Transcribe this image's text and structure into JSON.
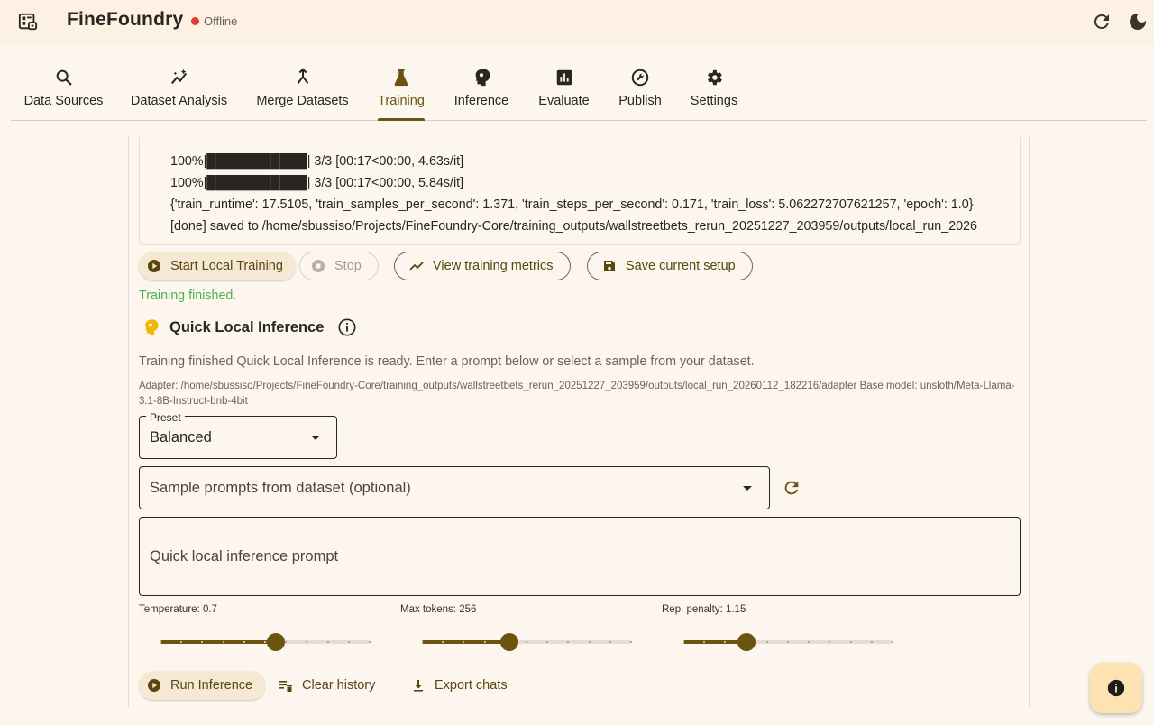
{
  "app": {
    "title": "FineFoundry",
    "status": "Offline",
    "status_color": "#e53935",
    "accent_color": "#6b5410",
    "icons": [
      "app-logo-icon",
      "refresh-icon",
      "dark-mode-icon"
    ]
  },
  "tabs": [
    {
      "label": "Data Sources",
      "icon": "search-icon"
    },
    {
      "label": "Dataset Analysis",
      "icon": "analytics-icon"
    },
    {
      "label": "Merge Datasets",
      "icon": "merge-icon"
    },
    {
      "label": "Training",
      "icon": "flask-icon",
      "active": true
    },
    {
      "label": "Inference",
      "icon": "psychology-icon"
    },
    {
      "label": "Evaluate",
      "icon": "bar-chart-icon"
    },
    {
      "label": "Publish",
      "icon": "publish-icon"
    },
    {
      "label": "Settings",
      "icon": "gear-icon"
    }
  ],
  "log": {
    "lines": [
      "100%|███████████| 3/3 [00:17<00:00,  4.63s/it]",
      "100%|███████████| 3/3 [00:17<00:00,  5.84s/it]",
      "{'train_runtime': 17.5105, 'train_samples_per_second': 1.371, 'train_steps_per_second': 0.171, 'train_loss': 5.062272707621257, 'epoch': 1.0}",
      "[done] saved to /home/sbussiso/Projects/FineFoundry-Core/training_outputs/wallstreetbets_rerun_20251227_203959/outputs/local_run_2026"
    ]
  },
  "actions": {
    "start_label": "Start Local Training",
    "stop_label": "Stop",
    "metrics_label": "View training metrics",
    "save_label": "Save current setup"
  },
  "training_status": "Training finished.",
  "inference": {
    "title": "Quick Local Inference",
    "description": "Training finished  Quick Local Inference is ready. Enter a prompt below or select a sample from your dataset.",
    "adapter_info": "Adapter: /home/sbussiso/Projects/FineFoundry-Core/training_outputs/wallstreetbets_rerun_20251227_203959/outputs/local_run_20260112_182216/adapter  Base model: unsloth/Meta-Llama-3.1-8B-Instruct-bnb-4bit",
    "preset_label": "Preset",
    "preset_value": "Balanced",
    "sample_placeholder": "Sample prompts from dataset (optional)",
    "prompt_placeholder": "Quick local inference prompt",
    "sliders": [
      {
        "label": "Temperature: 0.7",
        "fraction": 0.55
      },
      {
        "label": "Max tokens: 256",
        "fraction": 0.42
      },
      {
        "label": "Rep. penalty: 1.15",
        "fraction": 0.3
      }
    ],
    "run_label": "Run Inference",
    "clear_label": "Clear history",
    "export_label": "Export chats"
  }
}
